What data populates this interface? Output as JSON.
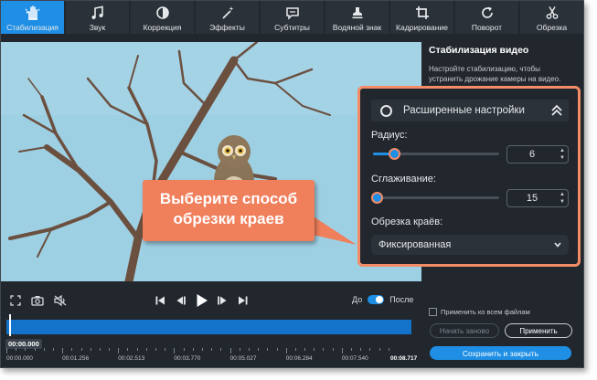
{
  "toolbar": {
    "items": [
      {
        "label": "Стабилизация",
        "icon": "hand-stabilize-icon",
        "active": true
      },
      {
        "label": "Звук",
        "icon": "music-note-icon",
        "active": false
      },
      {
        "label": "Коррекция",
        "icon": "contrast-icon",
        "active": false
      },
      {
        "label": "Эффекты",
        "icon": "magic-wand-icon",
        "active": false
      },
      {
        "label": "Субтитры",
        "icon": "speech-bubble-icon",
        "active": false
      },
      {
        "label": "Водяной знак",
        "icon": "stamp-icon",
        "active": false
      },
      {
        "label": "Кадрирование",
        "icon": "crop-icon",
        "active": false
      },
      {
        "label": "Поворот",
        "icon": "rotate-icon",
        "active": false
      },
      {
        "label": "Обрезка",
        "icon": "scissors-icon",
        "active": false
      }
    ]
  },
  "panel": {
    "title": "Стабилизация видео",
    "description": "Настройте стабилизацию, чтобы устранить дрожание камеры на видео."
  },
  "settings": {
    "advanced_label": "Расширенные настройки",
    "radius_label": "Радиус:",
    "radius_value": "6",
    "radius_fraction": 0.17,
    "smoothing_label": "Сглаживание:",
    "smoothing_value": "15",
    "smoothing_fraction": 0.0,
    "crop_label": "Обрезка краёв:",
    "crop_selected": "Фиксированная"
  },
  "callout": {
    "text": "Выберите способ обрезки краев"
  },
  "player": {
    "before_label": "До",
    "after_label": "После",
    "current_time": "00:00.000",
    "ticks": [
      "00:00.000",
      "00:01.256",
      "00:02.513",
      "00:03.770",
      "00:05.027",
      "00:06.284",
      "00:07.540",
      "00:08.717"
    ]
  },
  "actions": {
    "apply_all_label": "Применить ко всем файлам",
    "restart_label": "Начать заново",
    "apply_label": "Применить",
    "save_close_label": "Сохранить и закрыть"
  },
  "colors": {
    "accent": "#1f8fe5",
    "callout": "#f07f5c",
    "window_bg": "#22272e",
    "sky": "#9ed0e3"
  }
}
